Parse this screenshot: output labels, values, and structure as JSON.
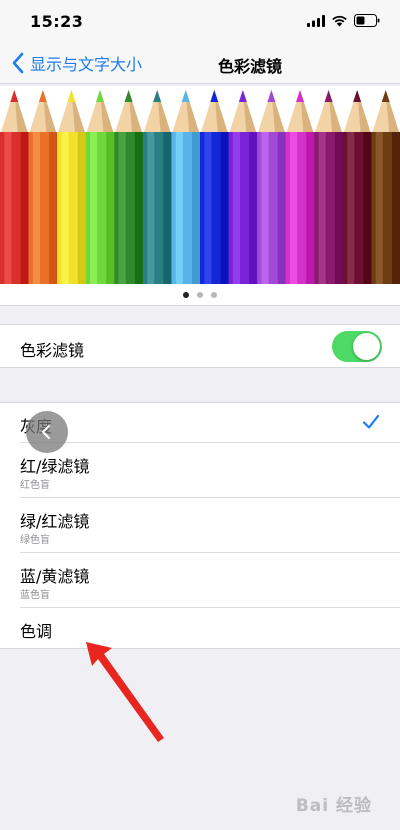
{
  "status": {
    "time": "15:23"
  },
  "nav": {
    "back_label": "显示与文字大小",
    "title": "色彩滤镜"
  },
  "carousel": {
    "dots": 3,
    "active_dot": 0
  },
  "toggle": {
    "label": "色彩滤镜",
    "on": true,
    "color": "#4cd964"
  },
  "filters": [
    {
      "title": "灰度",
      "subtitle": "",
      "selected": true
    },
    {
      "title": "红/绿滤镜",
      "subtitle": "红色盲",
      "selected": false
    },
    {
      "title": "绿/红滤镜",
      "subtitle": "绿色盲",
      "selected": false
    },
    {
      "title": "蓝/黄滤镜",
      "subtitle": "蓝色盲",
      "selected": false
    },
    {
      "title": "色调",
      "subtitle": "",
      "selected": false
    }
  ],
  "watermark": "Bai 经验",
  "colors": {
    "accent": "#1c7cf2",
    "pencils": [
      "#d8312c",
      "#e8712a",
      "#f0e12c",
      "#6fd83a",
      "#2e8a2a",
      "#2a7f83",
      "#5ab3e8",
      "#1428d8",
      "#7a22d8",
      "#a24ad8",
      "#d431c8",
      "#8a1a6e",
      "#6b1030",
      "#6e3d12"
    ]
  }
}
